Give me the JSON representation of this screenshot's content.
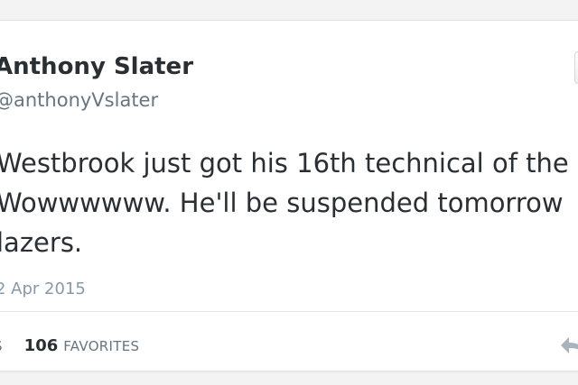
{
  "tweet": {
    "author_name": "Anthony Slater",
    "handle": "@anthonyVslater",
    "text_lines": [
      "Westbrook just got his 16th technical of the",
      "Wowwwwww. He'll be suspended tomorrow",
      "lazers."
    ],
    "date": "2 Apr 2015",
    "retweets_label": "S",
    "favorites_count": "106",
    "favorites_label": "FAVORITES"
  },
  "icons": {
    "reply": "reply-arrow-icon",
    "follow": "follow-button"
  }
}
